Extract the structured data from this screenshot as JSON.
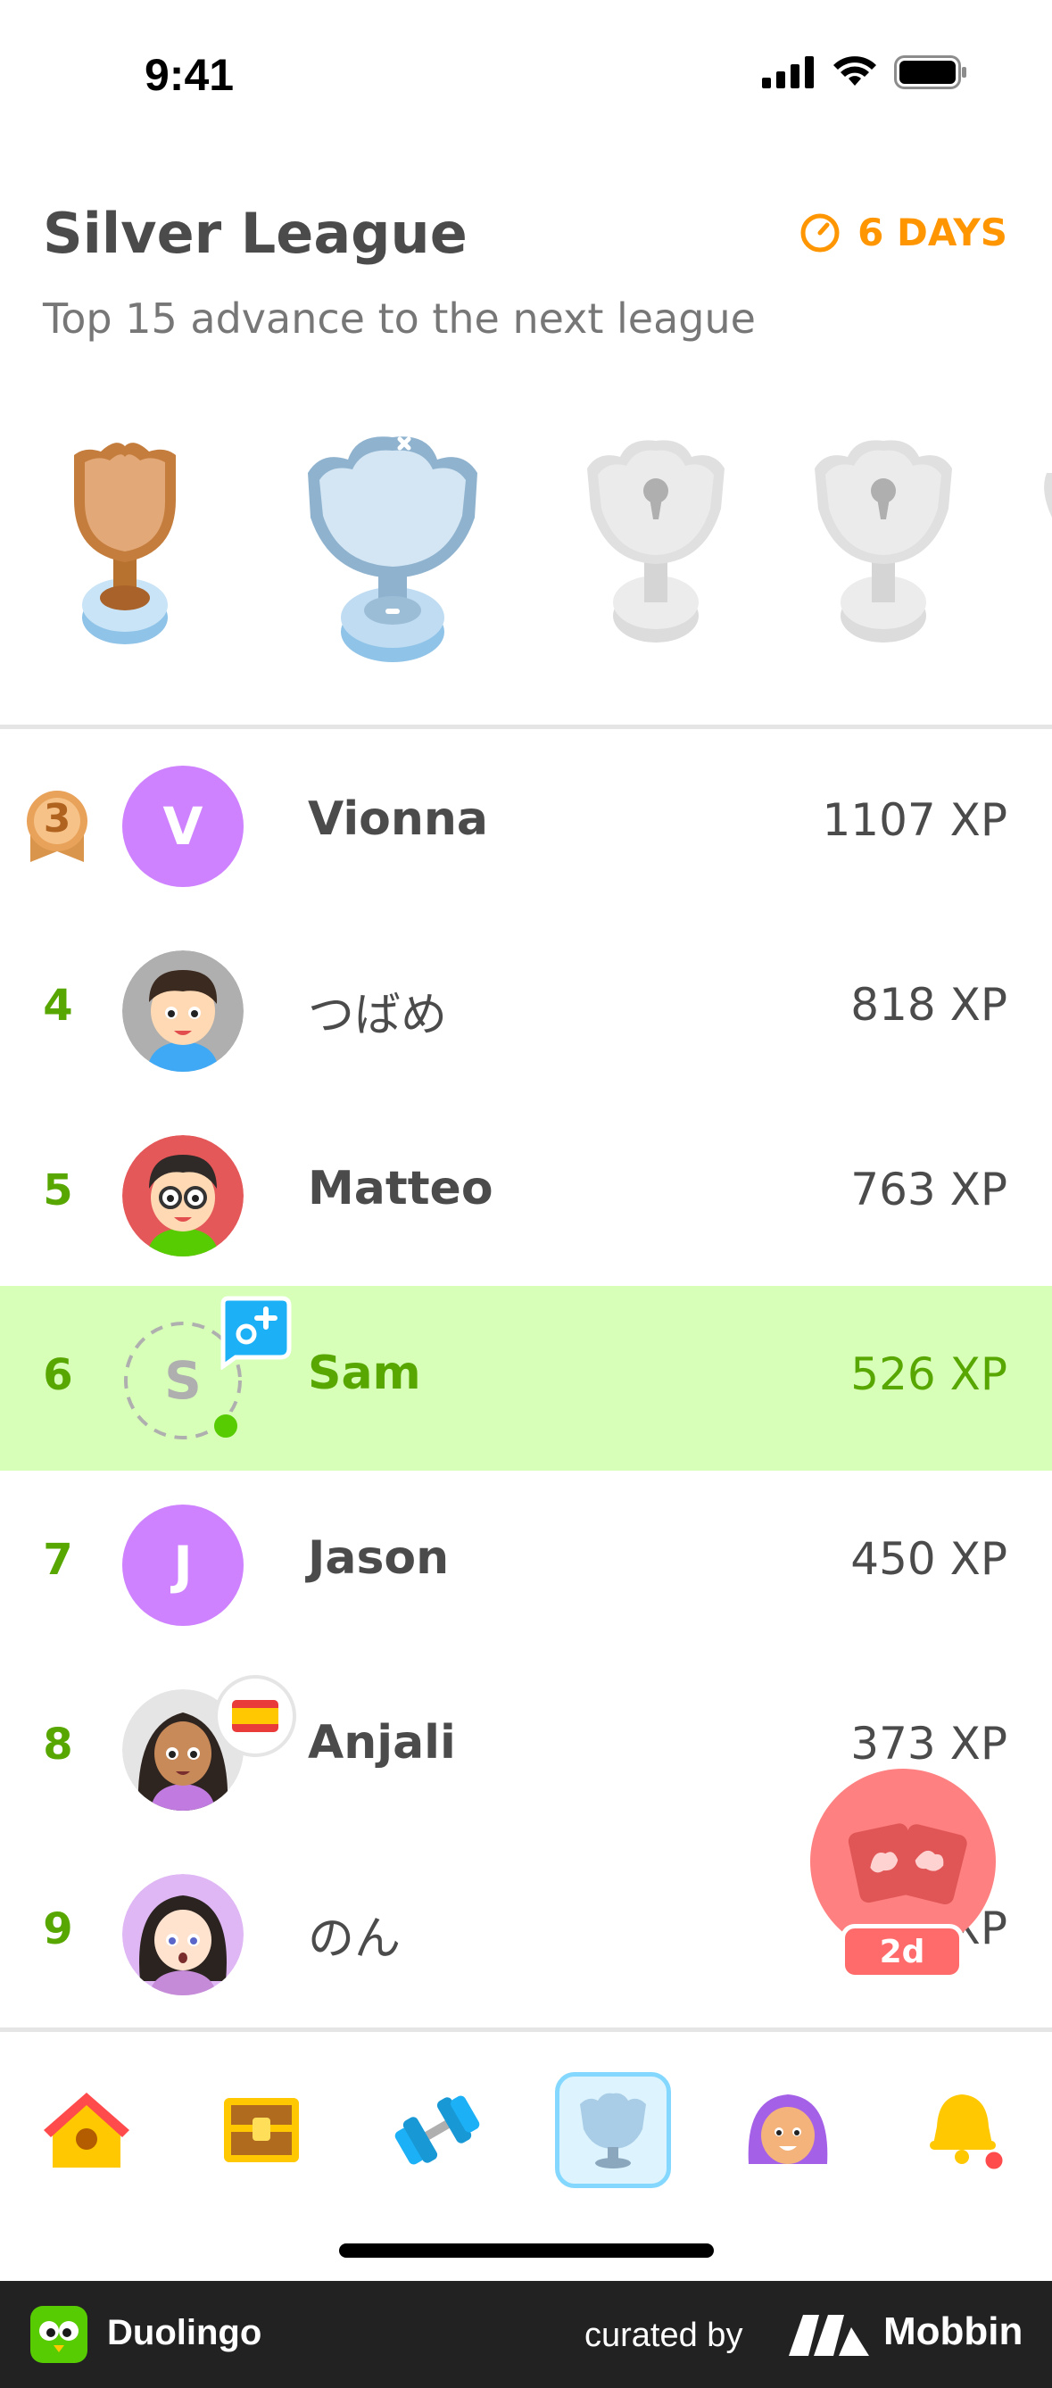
{
  "status_bar": {
    "time": "9:41"
  },
  "header": {
    "title": "Silver League",
    "timer": "6 DAYS",
    "subtitle": "Top 15 advance to the next league"
  },
  "leaderboard": [
    {
      "rank": "3",
      "name": "Vionna",
      "xp": "1107 XP",
      "avatar_letter": "V"
    },
    {
      "rank": "4",
      "name": "つばめ",
      "xp": "818 XP"
    },
    {
      "rank": "5",
      "name": "Matteo",
      "xp": "763 XP"
    },
    {
      "rank": "6",
      "name": "Sam",
      "xp": "526 XP",
      "avatar_letter": "S"
    },
    {
      "rank": "7",
      "name": "Jason",
      "xp": "450 XP",
      "avatar_letter": "J"
    },
    {
      "rank": "8",
      "name": "Anjali",
      "xp": "373 XP"
    },
    {
      "rank": "9",
      "name": "のん",
      "xp": "XP"
    }
  ],
  "floating_chest": {
    "badge": "2d"
  },
  "footer": {
    "app_name": "Duolingo",
    "curated_by": "curated by",
    "brand": "Mobbin"
  },
  "colors": {
    "green": "#58a700",
    "highlight": "#d7ffb8",
    "orange": "#ff9600",
    "purple": "#ce82ff"
  },
  "nav": [
    "home-icon",
    "chest-icon",
    "dumbbell-icon",
    "trophy-icon",
    "profile-icon",
    "bell-icon"
  ]
}
